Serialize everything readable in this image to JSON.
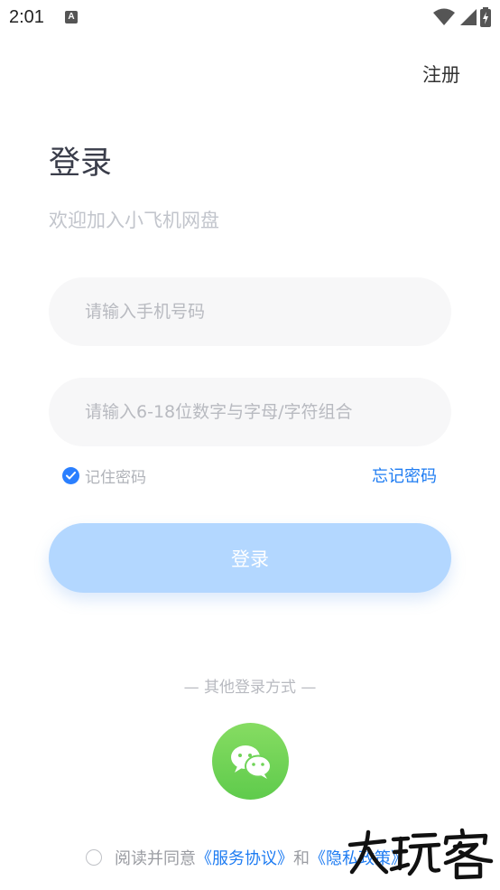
{
  "status_bar": {
    "time": "2:01",
    "notification_badge": "A"
  },
  "header": {
    "register_label": "注册"
  },
  "main": {
    "title": "登录",
    "subtitle": "欢迎加入小飞机网盘",
    "phone_placeholder": "请输入手机号码",
    "password_placeholder": "请输入6-18位数字与字母/字符组合",
    "remember_label": "记住密码",
    "remember_checked": true,
    "forgot_label": "忘记密码",
    "login_label": "登录"
  },
  "other_login": {
    "label": "— 其他登录方式 —",
    "wechat_icon": "wechat-icon"
  },
  "agreement": {
    "prefix": "阅读并同意",
    "service_link": "《服务协议》",
    "and": "和",
    "privacy_link": "《隐私政策》"
  },
  "colors": {
    "primary": "#1e7cf2",
    "login_button_bg": "#b3d7ff",
    "input_bg": "#f7f7f8",
    "wechat_green": "#6fd357"
  }
}
